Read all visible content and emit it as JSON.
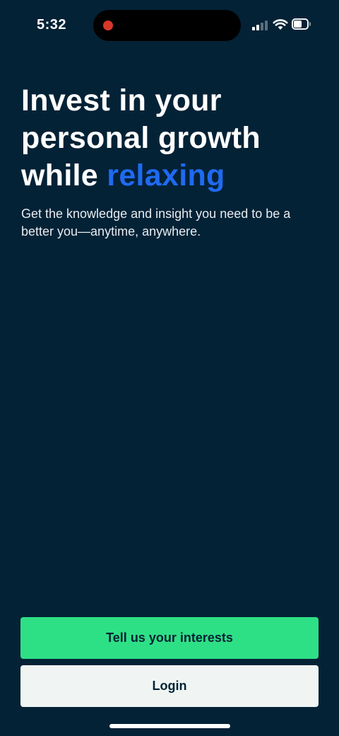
{
  "status_bar": {
    "time": "5:32",
    "recording_dot_color": "#d9372b",
    "icons": [
      "signal-icon",
      "wifi-icon",
      "battery-icon"
    ]
  },
  "hero": {
    "title_line_1": "Invest in your",
    "title_line_2": "personal growth",
    "title_line_3_prefix": "while ",
    "title_line_3_accent": "relaxing",
    "subtitle": "Get the knowledge and insight you need to be a better you—anytime, anywhere."
  },
  "actions": {
    "primary_label": "Tell us your interests",
    "secondary_label": "Login"
  },
  "colors": {
    "background": "#042236",
    "accent_blue": "#1f6af2",
    "primary_button": "#2ee085",
    "secondary_button": "#f0f5f4"
  }
}
